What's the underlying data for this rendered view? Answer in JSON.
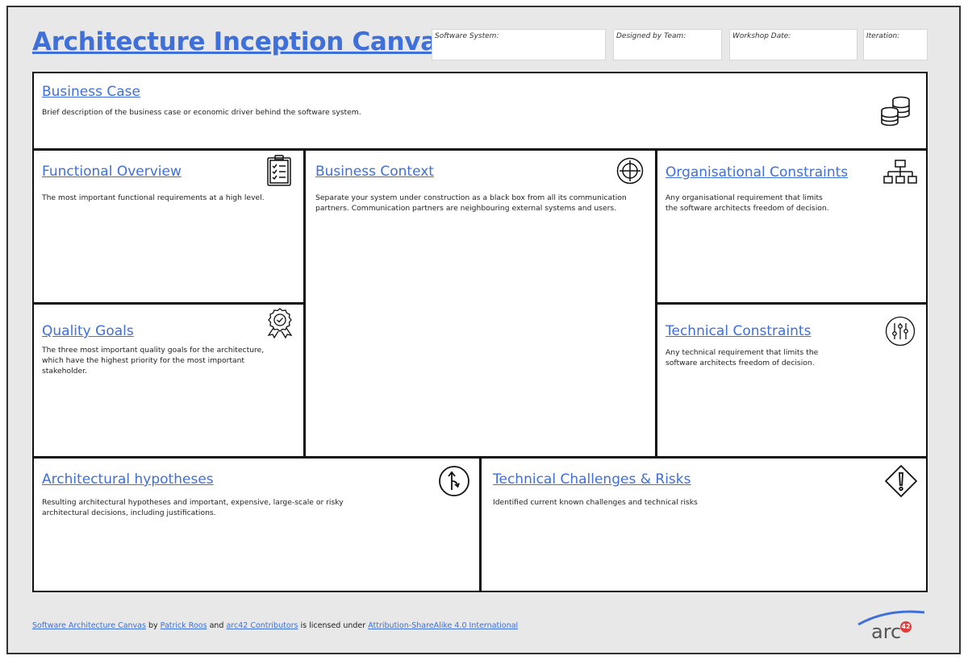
{
  "title": "Architecture Inception Canvas",
  "meta": [
    {
      "label": "Software System:",
      "value": ""
    },
    {
      "label": "Designed by Team:",
      "value": ""
    },
    {
      "label": "Workshop Date:",
      "value": ""
    },
    {
      "label": "Iteration:",
      "value": ""
    }
  ],
  "sections": {
    "business_case": {
      "title": "Business Case",
      "desc": "Brief description of the business case or economic driver behind the software system.",
      "icon": "coins-stack-icon"
    },
    "functional_overview": {
      "title": "Functional Overview",
      "desc": "The most important functional requirements  at a high level.",
      "icon": "checklist-clipboard-icon"
    },
    "business_context": {
      "title": "Business Context",
      "desc_1": "Separate your system under construction as a black box from all its communication",
      "desc_2": "partners. Communication partners are neighbouring external systems and users.",
      "icon": "target-crosshair-icon"
    },
    "org_constraints": {
      "title": "Organisational Constraints",
      "desc_1": "Any organisational requirement that limits",
      "desc_2": "the software architects freedom of decision.",
      "icon": "org-chart-icon"
    },
    "quality_goals": {
      "title": "Quality Goals",
      "desc_1": "The three most important quality goals for the architecture,",
      "desc_2": "which have the highest priority for the most important",
      "desc_3": "stakeholder.",
      "icon": "award-badge-icon"
    },
    "tech_constraints": {
      "title": "Technical Constraints",
      "desc_1": "Any technical requirement that limits the",
      "desc_2": "software architects freedom of decision.",
      "icon": "sliders-icon"
    },
    "arch_hypotheses": {
      "title": "Architectural hypotheses",
      "desc_1": "Resulting architectural hypotheses and important, expensive, large-scale or risky",
      "desc_2": "architectural decisions, including justifications.",
      "icon": "merge-arrow-icon"
    },
    "tech_risks": {
      "title": "Technical Challenges & Risks",
      "desc": "Identified current known challenges and technical risks",
      "icon": "warning-diamond-icon"
    }
  },
  "footer": {
    "link1": "Software Architecture Canvas",
    "text1": " by ",
    "link2": "Patrick Roos",
    "text2": " and ",
    "link3": "arc42 Contributors",
    "text3": " is licensed under ",
    "link4": "Attribution-ShareAlike 4.0 International"
  },
  "logo": {
    "text": "arc",
    "badge": "42"
  }
}
